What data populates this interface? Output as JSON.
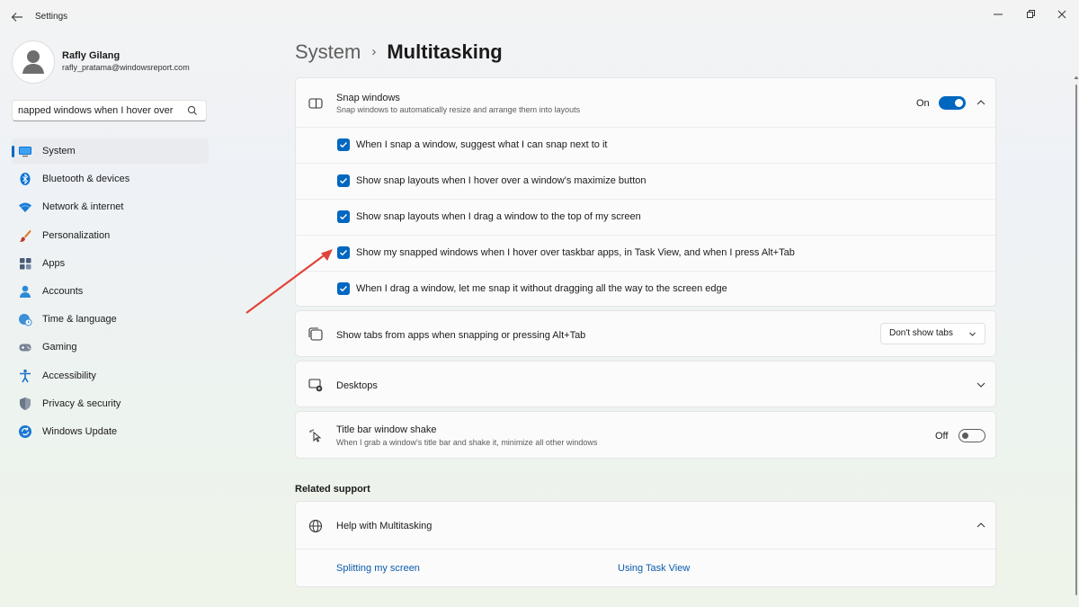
{
  "window": {
    "title": "Settings"
  },
  "user": {
    "name": "Rafly Gilang",
    "email": "rafly_pratama@windowsreport.com"
  },
  "search": {
    "value": "napped windows when I hover over"
  },
  "nav": [
    {
      "label": "System",
      "icon": "monitor-icon"
    },
    {
      "label": "Bluetooth & devices",
      "icon": "bluetooth-icon"
    },
    {
      "label": "Network & internet",
      "icon": "wifi-icon"
    },
    {
      "label": "Personalization",
      "icon": "brush-icon"
    },
    {
      "label": "Apps",
      "icon": "apps-icon"
    },
    {
      "label": "Accounts",
      "icon": "person-icon"
    },
    {
      "label": "Time & language",
      "icon": "globe-clock-icon"
    },
    {
      "label": "Gaming",
      "icon": "gamepad-icon"
    },
    {
      "label": "Accessibility",
      "icon": "accessibility-icon"
    },
    {
      "label": "Privacy & security",
      "icon": "shield-icon"
    },
    {
      "label": "Windows Update",
      "icon": "update-icon"
    }
  ],
  "breadcrumb": {
    "parent": "System",
    "separator": "›",
    "current": "Multitasking"
  },
  "snap": {
    "title": "Snap windows",
    "desc": "Snap windows to automatically resize and arrange them into layouts",
    "state": "On",
    "options": [
      {
        "label": "When I snap a window, suggest what I can snap next to it",
        "checked": true
      },
      {
        "label": "Show snap layouts when I hover over a window's maximize button",
        "checked": true
      },
      {
        "label": "Show snap layouts when I drag a window to the top of my screen",
        "checked": true
      },
      {
        "label": "Show my snapped windows when I hover over taskbar apps, in Task View, and when I press Alt+Tab",
        "checked": true
      },
      {
        "label": "When I drag a window, let me snap it without dragging all the way to the screen edge",
        "checked": true
      }
    ]
  },
  "tabs": {
    "label": "Show tabs from apps when snapping or pressing Alt+Tab",
    "value": "Don't show tabs"
  },
  "desktops": {
    "label": "Desktops"
  },
  "shake": {
    "title": "Title bar window shake",
    "desc": "When I grab a window's title bar and shake it, minimize all other windows",
    "state": "Off"
  },
  "related": {
    "heading": "Related support",
    "help_title": "Help with Multitasking",
    "links": [
      "Splitting my screen",
      "Using Task View"
    ]
  },
  "colors": {
    "accent": "#0067c0",
    "annotation_arrow": "#e0443a"
  }
}
